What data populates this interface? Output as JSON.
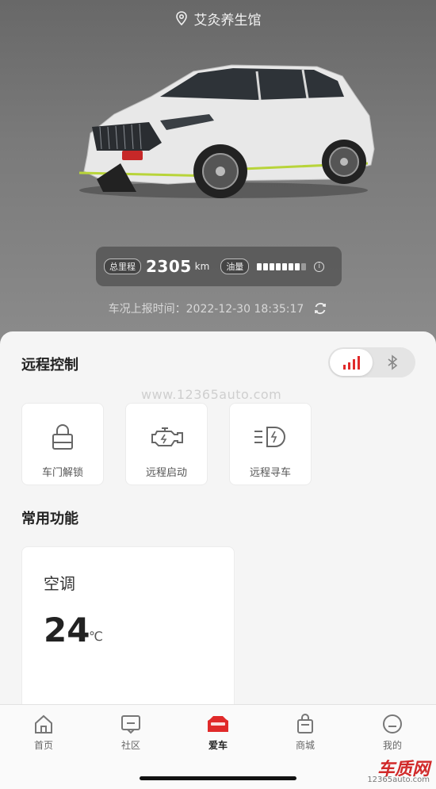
{
  "header": {
    "location": "艾灸养生馆",
    "location_icon": "location-pin-icon"
  },
  "stats": {
    "mileage_label": "总里程",
    "mileage_value": "2305",
    "mileage_unit": "km",
    "fuel_label": "油量",
    "fuel_level_fraction": 0.875,
    "info_icon": "info-icon"
  },
  "report": {
    "text": "车况上报时间：2022-12-30 18:35:17",
    "refresh_icon": "refresh-icon"
  },
  "remote": {
    "title": "远程控制",
    "toggle": {
      "active": "signal-icon",
      "inactive": "bluetooth-icon"
    },
    "controls": [
      {
        "label": "车门解锁",
        "icon": "lock-icon"
      },
      {
        "label": "远程启动",
        "icon": "engine-icon"
      },
      {
        "label": "远程寻车",
        "icon": "headlight-icon"
      }
    ]
  },
  "watermark": "www.12365auto.com",
  "common": {
    "title": "常用功能",
    "ac": {
      "title": "空调",
      "temperature": "24",
      "unit": "℃"
    }
  },
  "tabbar": {
    "tabs": [
      {
        "label": "首页",
        "icon": "home-icon"
      },
      {
        "label": "社区",
        "icon": "community-icon"
      },
      {
        "label": "爱车",
        "icon": "car-icon",
        "active": true
      },
      {
        "label": "商城",
        "icon": "shop-bag-icon"
      },
      {
        "label": "我的",
        "icon": "profile-icon"
      }
    ]
  },
  "brand_watermark": {
    "text": "车质网",
    "url_text": "12365auto.com"
  },
  "colors": {
    "accent": "#e02a2a",
    "hero_bg": "#7a7a7a",
    "panel_bg": "#f5f5f5"
  }
}
